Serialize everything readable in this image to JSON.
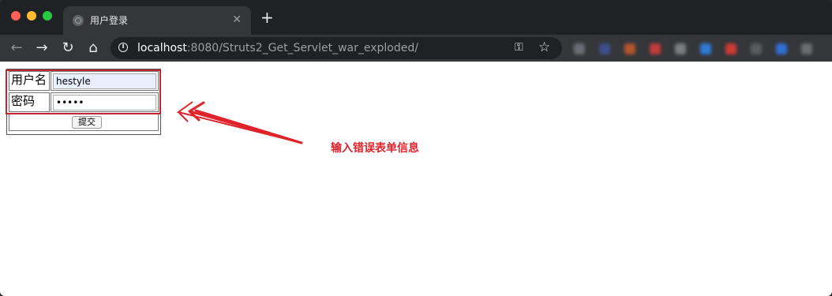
{
  "browser": {
    "tab_title": "用户登录",
    "tab_close": "✕",
    "new_tab": "+",
    "url_host": "localhost",
    "url_rest": ":8080/Struts2_Get_Servlet_war_exploded/",
    "extension_colors": [
      "#6b6e74",
      "#3d4f8a",
      "#b3562e",
      "#c33c3c",
      "#7a7d82",
      "#2e7bd6",
      "#cf3b35",
      "#5a5d62",
      "#2f6fd4",
      "#6a6d72"
    ]
  },
  "form": {
    "username_label": "用户名",
    "username_value": "hestyle",
    "password_label": "密码",
    "password_value": "•••••",
    "submit_label": "提交"
  },
  "annotation": {
    "text": "输入错误表单信息",
    "color": "#e0232b"
  }
}
